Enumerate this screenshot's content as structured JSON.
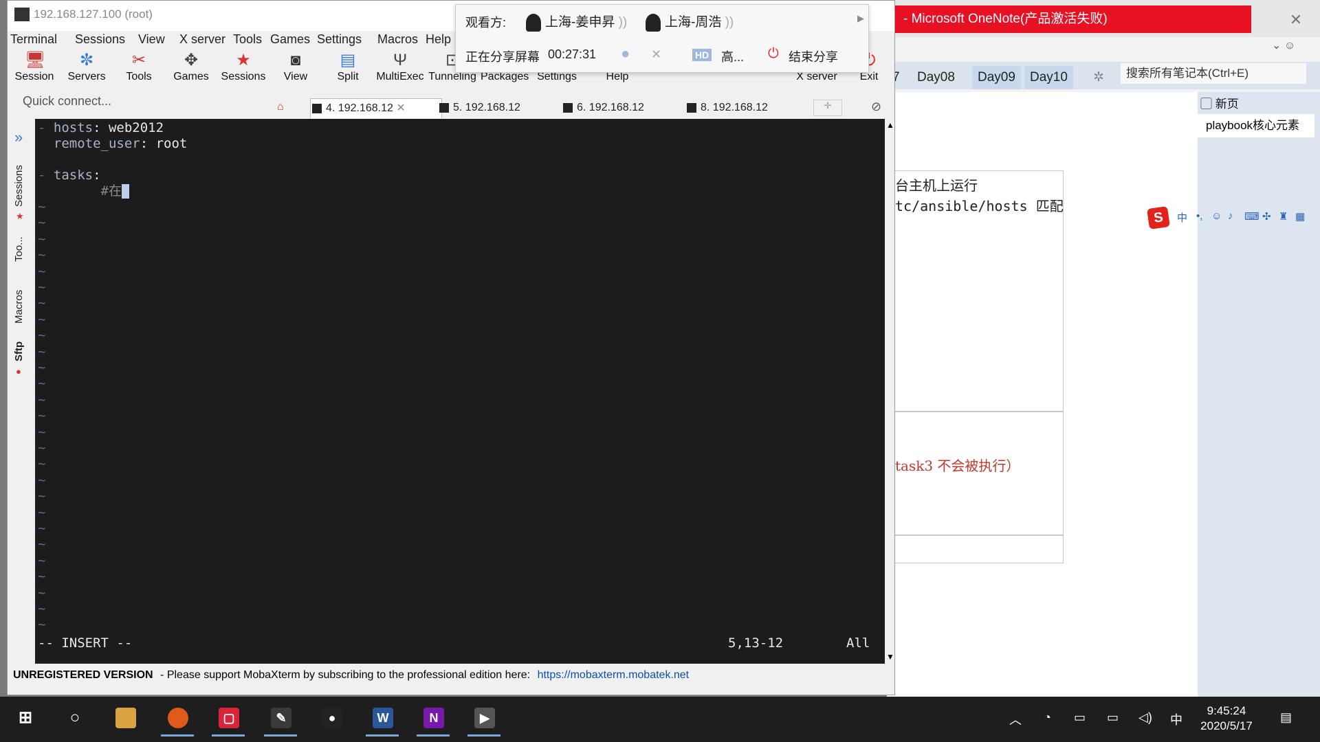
{
  "onenote": {
    "title": "- Microsoft OneNote(产品激活失败)",
    "tabs": [
      "7",
      "Day08",
      "Day09",
      "Day10"
    ],
    "search_placeholder": "搜索所有笔记本(Ctrl+E)",
    "new_page": "新页",
    "page_item": "playbook核心元素",
    "note_line1": "台主机上运行",
    "note_line2": "tc/ansible/hosts 匹配",
    "note_line3": "task3 不会被执行）"
  },
  "moba": {
    "title": "192.168.127.100 (root)",
    "menus": [
      "Terminal",
      "Sessions",
      "View",
      "X server",
      "Tools",
      "Games",
      "Settings",
      "Macros",
      "Help"
    ],
    "toolbar": [
      "Session",
      "Servers",
      "Tools",
      "Games",
      "Sessions",
      "View",
      "Split",
      "MultiExec",
      "Tunneling",
      "Packages",
      "Settings",
      "Help",
      "X server",
      "Exit"
    ],
    "quick_connect": "Quick connect...",
    "tabs": [
      "4. 192.168.12",
      "5. 192.168.12",
      "6. 192.168.12",
      "8. 192.168.12"
    ],
    "side_tabs": [
      "Sessions",
      "Too...",
      "Macros",
      "Sftp"
    ],
    "terminal": {
      "lines": [
        "- hosts: web2012",
        "  remote_user: root",
        "",
        "- tasks:",
        "        #在"
      ],
      "status_mode": "-- INSERT --",
      "status_pos": "5,13-12",
      "status_all": "All"
    },
    "footer_bold": "UNREGISTERED VERSION",
    "footer_text": "-  Please support MobaXterm by subscribing to the professional edition here:",
    "footer_link": "https://mobaxterm.mobatek.net"
  },
  "share": {
    "viewers_label": "观看方:",
    "viewer1": "上海-姜申昇",
    "viewer2": "上海-周浩",
    "sharing_label": "正在分享屏幕",
    "timer": "00:27:31",
    "hd_badge": "HD",
    "quality": "高...",
    "end_share": "结束分享"
  },
  "taskbar": {
    "time": "9:45:24",
    "date": "2020/5/17",
    "ime": "中"
  }
}
